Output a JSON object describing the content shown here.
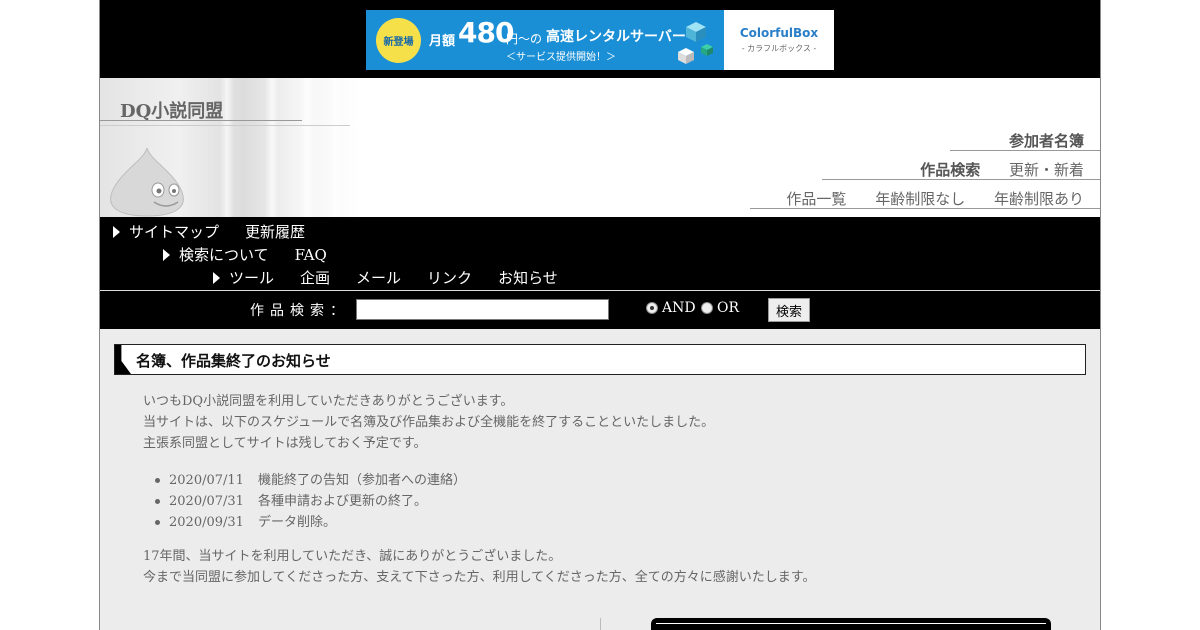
{
  "ad": {
    "badge": "新登場",
    "prefix": "月額",
    "price": "480",
    "unit": "円〜の",
    "text": "高速レンタルサーバー",
    "sub": "＜サービス提供開始！＞",
    "brand": "ColorfulBox",
    "brand_sub": "- カラフルボックス -"
  },
  "site": {
    "title": "DQ小説同盟"
  },
  "header_nav": {
    "row1": [
      "参加者名簿"
    ],
    "row2": [
      "作品検索",
      "更新・新着"
    ],
    "row3": [
      "作品一覧",
      "年齢制限なし",
      "年齢制限あり"
    ]
  },
  "nav": {
    "row1": [
      "サイトマップ",
      "更新履歴"
    ],
    "row2": [
      "検索について",
      "FAQ"
    ],
    "row3": [
      "ツール",
      "企画",
      "メール",
      "リンク",
      "お知らせ"
    ]
  },
  "search": {
    "label": "作品検索：",
    "input_value": "",
    "options": [
      "AND",
      "OR"
    ],
    "selected": "AND",
    "button": "検索"
  },
  "notice": {
    "title": "名簿、作品集終了のお知らせ",
    "intro": [
      "いつもDQ小説同盟を利用していただきありがとうございます。",
      "当サイトは、以下のスケジュールで名簿及び作品集および全機能を終了することといたしました。",
      "主張系同盟としてサイトは残しておく予定です。"
    ],
    "schedule": [
      {
        "date": "2020/07/11",
        "text": "機能終了の告知（参加者への連絡）"
      },
      {
        "date": "2020/07/31",
        "text": "各種申請および更新の終了。"
      },
      {
        "date": "2020/09/31",
        "text": "データ削除。"
      }
    ],
    "closing": [
      "17年間、当サイトを利用していただき、誠にありがとうございました。",
      "今まで当同盟に参加してくださった方、支えて下さった方、利用してくださった方、全ての方々に感謝いたします。"
    ]
  },
  "colors": {
    "accent": "#1a8fd6",
    "nav_bg": "#000000",
    "content_bg": "#ececec"
  }
}
